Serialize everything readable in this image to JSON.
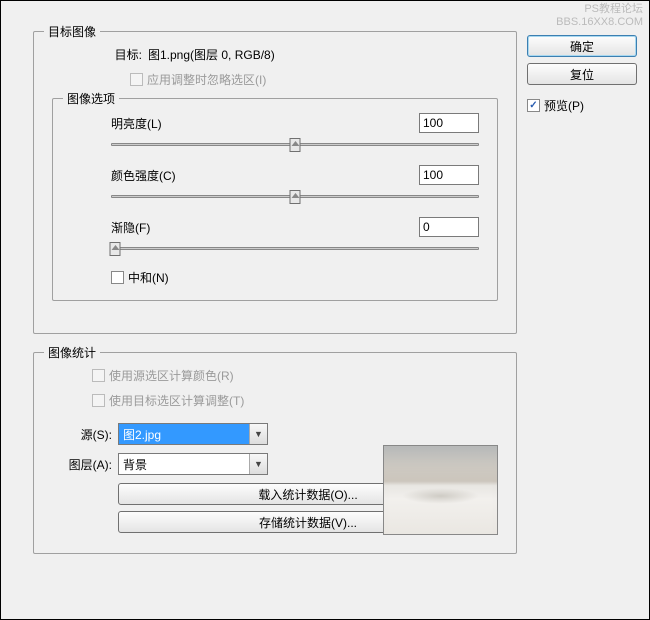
{
  "watermark": {
    "line1": "PS教程论坛",
    "line2": "BBS.16XX8.COM"
  },
  "buttons": {
    "ok": "确定",
    "reset": "复位"
  },
  "preview_checkbox": "预览(P)",
  "target_image": {
    "legend": "目标图像",
    "target_label": "目标:",
    "target_value": "图1.png(图层 0, RGB/8)",
    "ignore_selection": "应用调整时忽略选区(I)"
  },
  "image_options": {
    "legend": "图像选项",
    "luminance": {
      "label": "明亮度(L)",
      "value": "100"
    },
    "color_intensity": {
      "label": "颜色强度(C)",
      "value": "100"
    },
    "fade": {
      "label": "渐隐(F)",
      "value": "0"
    },
    "neutralize": "中和(N)"
  },
  "image_stats": {
    "legend": "图像统计",
    "use_source_selection": "使用源选区计算颜色(R)",
    "use_target_selection": "使用目标选区计算调整(T)",
    "source_label": "源(S):",
    "source_value": "图2.jpg",
    "layer_label": "图层(A):",
    "layer_value": "背景",
    "load_stats": "载入统计数据(O)...",
    "save_stats": "存储统计数据(V)..."
  }
}
